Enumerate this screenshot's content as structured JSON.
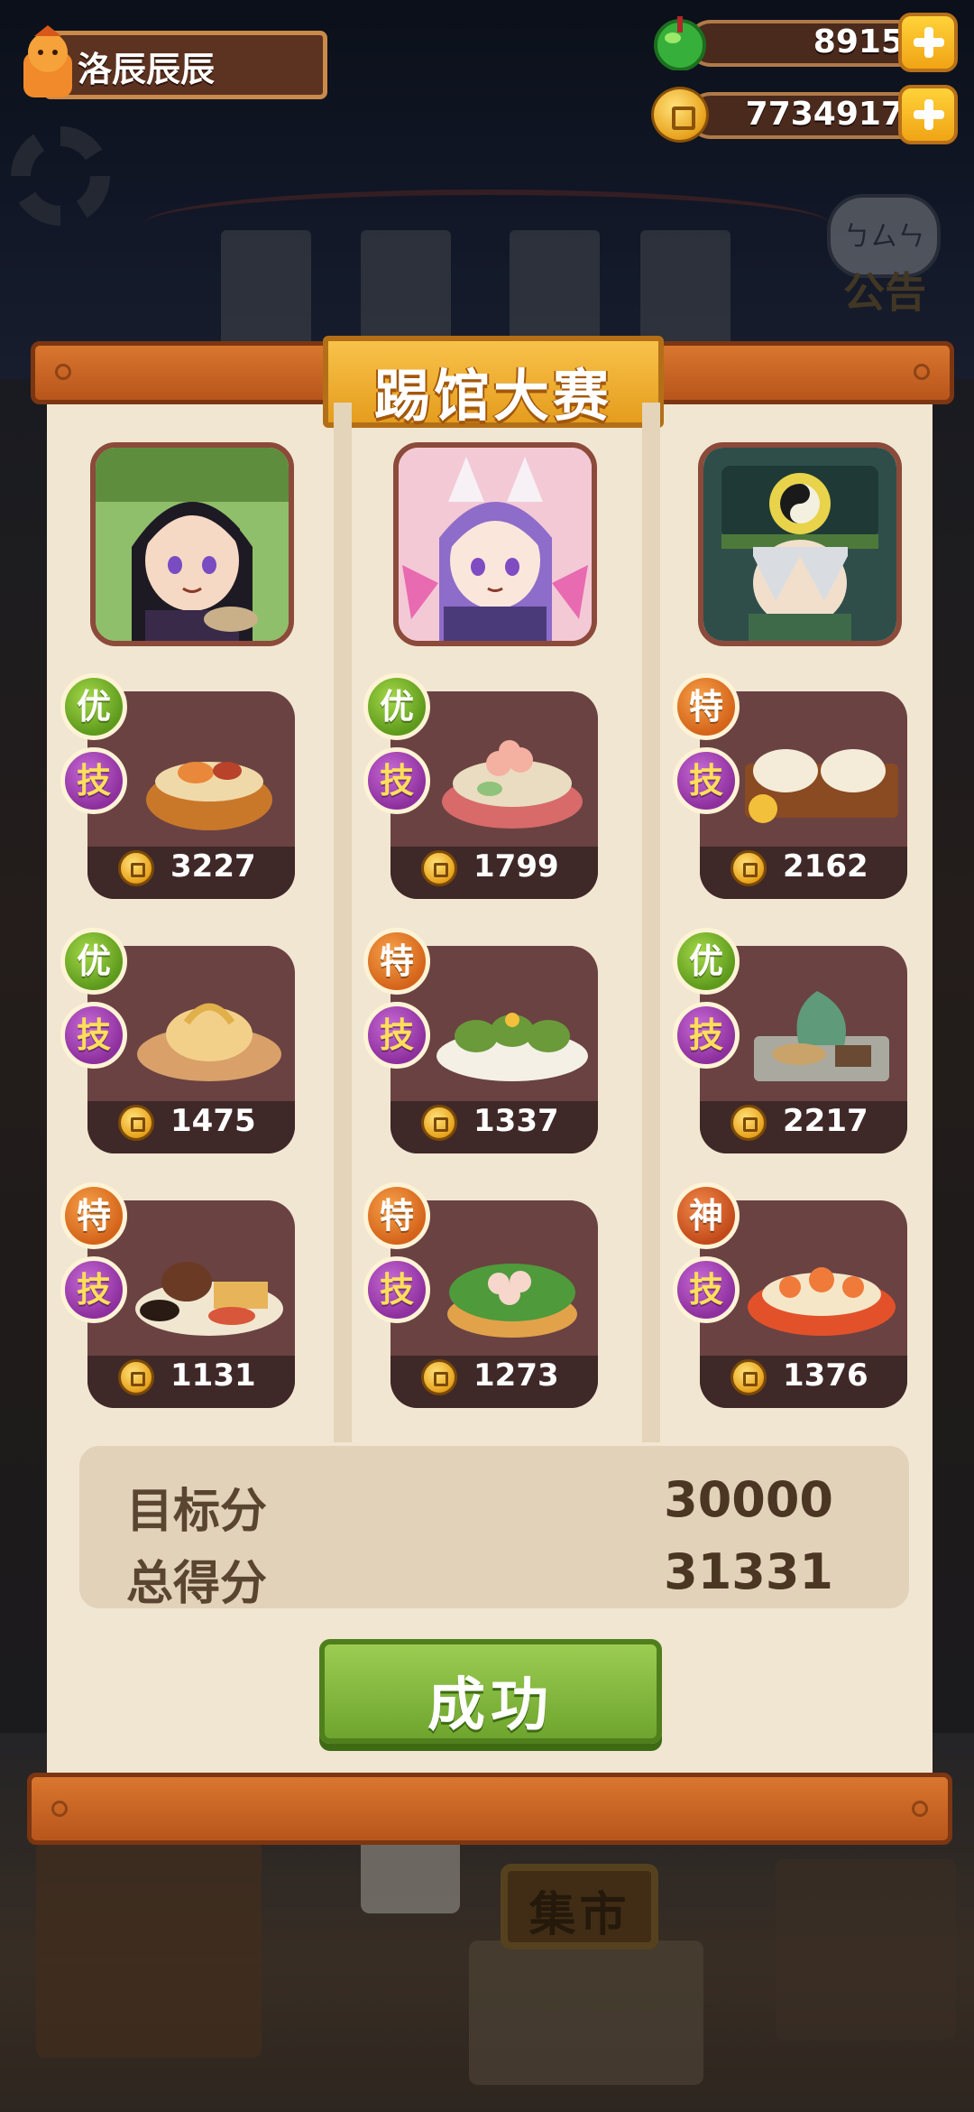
{
  "player": {
    "name": "洛辰辰辰"
  },
  "resources": {
    "gems": "8915",
    "coins": "7734917"
  },
  "background": {
    "notice_label": "公告",
    "notice_bubble": "ㄅㄙㄣ",
    "market_label": "集市"
  },
  "dialog": {
    "title": "踢馆大赛",
    "skill_badge": "技",
    "columns": [
      {
        "chef": "chef-1",
        "dishes": [
          {
            "grade": "优",
            "price": "3227"
          },
          {
            "grade": "优",
            "price": "1475"
          },
          {
            "grade": "特",
            "price": "1131"
          }
        ]
      },
      {
        "chef": "chef-2",
        "dishes": [
          {
            "grade": "优",
            "price": "1799"
          },
          {
            "grade": "特",
            "price": "1337"
          },
          {
            "grade": "特",
            "price": "1273"
          }
        ]
      },
      {
        "chef": "chef-3",
        "dishes": [
          {
            "grade": "特",
            "price": "2162"
          },
          {
            "grade": "优",
            "price": "2217"
          },
          {
            "grade": "神",
            "price": "1376"
          }
        ]
      }
    ],
    "target_label": "目标分",
    "target_value": "30000",
    "total_label": "总得分",
    "total_value": "31331",
    "success_label": "成功"
  },
  "colors": {
    "panel": "#f1e6d2",
    "rail": "#c9621f",
    "title_plate": "#f0b032",
    "success_button": "#86ba3f"
  }
}
